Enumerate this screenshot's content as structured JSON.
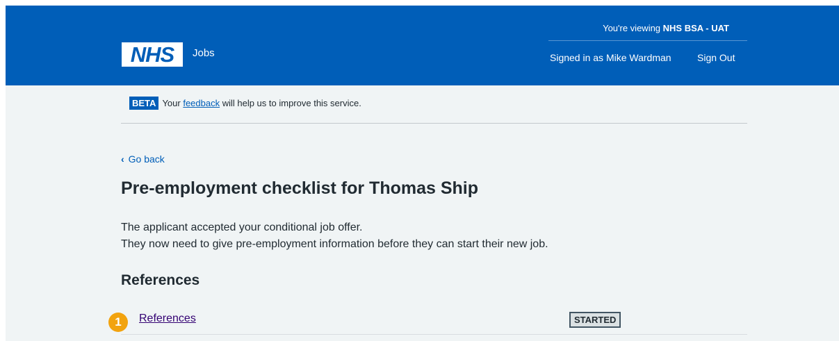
{
  "header": {
    "viewing_prefix": "You're viewing ",
    "viewing_org": "NHS BSA - UAT",
    "logo_text": "NHS",
    "service_name": "Jobs",
    "signed_in_text": "Signed in as Mike Wardman",
    "sign_out_label": "Sign Out",
    "background_color": "#005eb8"
  },
  "beta_banner": {
    "tag": "BETA",
    "text_before": "Your ",
    "link_text": "feedback",
    "text_after": " will help us to improve this service."
  },
  "nav": {
    "back_icon": "chevron-left-icon",
    "back_label": "Go back"
  },
  "main": {
    "title": "Pre-employment checklist for Thomas Ship",
    "intro_line1": "The applicant accepted your conditional job offer.",
    "intro_line2": "They now need to give pre-employment information before they can start their new job.",
    "section_heading": "References",
    "tasks": [
      {
        "label": "References",
        "status": "STARTED"
      }
    ]
  },
  "annotation": {
    "marker": "1",
    "color": "#f2a30f"
  }
}
